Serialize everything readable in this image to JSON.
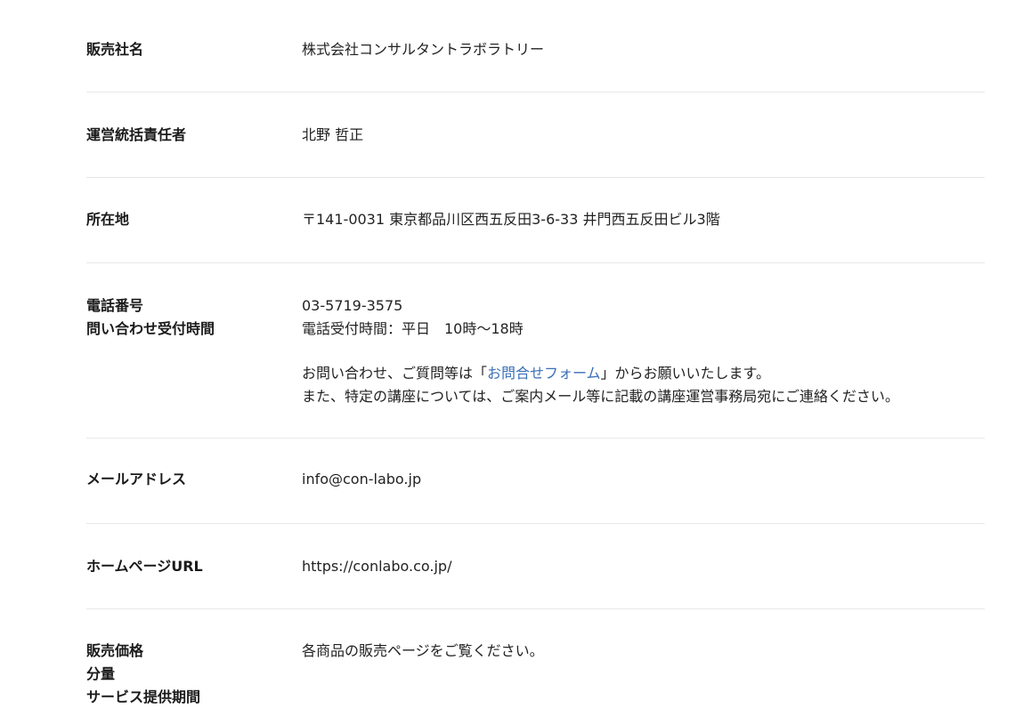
{
  "rows": [
    {
      "label_lines": [
        "販売社名"
      ],
      "value_lines": [
        "株式会社コンサルタントラボラトリー"
      ]
    },
    {
      "label_lines": [
        "運営統括責任者"
      ],
      "value_lines": [
        "北野 哲正"
      ]
    },
    {
      "label_lines": [
        "所在地"
      ],
      "value_lines": [
        "〒141-0031 東京都品川区西五反田3-6-33 井門西五反田ビル3階"
      ]
    },
    {
      "label_lines": [
        "電話番号",
        "問い合わせ受付時間"
      ],
      "value_lines": [
        "03-5719-3575",
        "電話受付時間：平日　10時～18時"
      ],
      "inquiry": {
        "before_link": "お問い合わせ、ご質問等は「",
        "link_text": "お問合せフォーム",
        "after_link": "」からお願いいたします。",
        "second_line": "また、特定の講座については、ご案内メール等に記載の講座運営事務局宛にご連絡ください。"
      }
    },
    {
      "label_lines": [
        "メールアドレス"
      ],
      "value_lines": [
        "info@con-labo.jp"
      ]
    },
    {
      "label_lines": [
        "ホームページURL"
      ],
      "value_lines": [
        "https://conlabo.co.jp/"
      ]
    },
    {
      "label_lines": [
        "販売価格",
        "分量",
        "サービス提供期間"
      ],
      "value_lines": [
        "各商品の販売ページをご覧ください。"
      ]
    }
  ],
  "colors": {
    "link": "#3b6fb6",
    "divider": "#e8e8e8",
    "text": "#222222"
  }
}
